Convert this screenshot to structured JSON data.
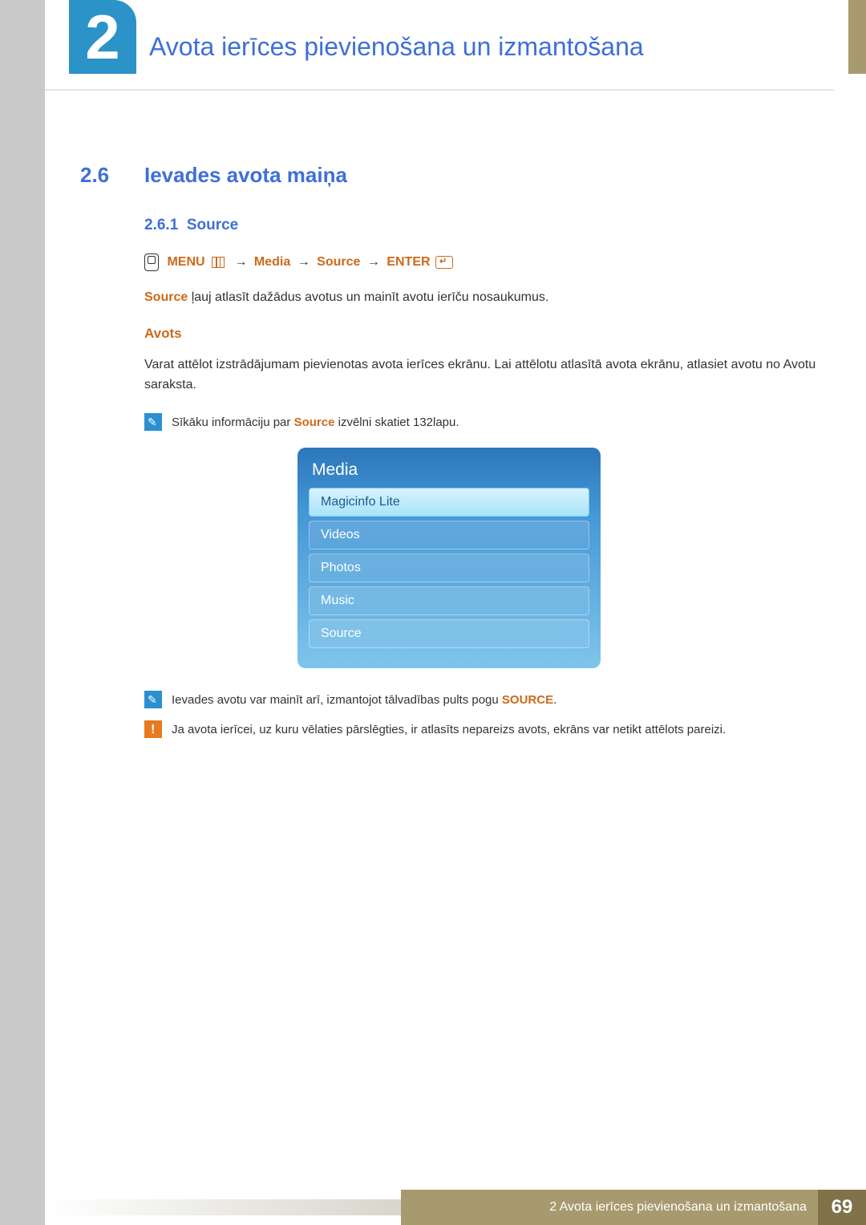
{
  "chapter": {
    "number": "2",
    "title": "Avota ierīces pievienošana un izmantošana"
  },
  "section": {
    "number": "2.6",
    "title": "Ievades avota maiņa"
  },
  "subsection": {
    "number": "2.6.1",
    "title": "Source"
  },
  "breadcrumb": {
    "menu": "MENU",
    "path1": "Media",
    "path2": "Source",
    "enter": "ENTER"
  },
  "intro": {
    "source_word": "Source",
    "rest": " ļauj atlasīt dažādus avotus un mainīt avotu ierīču nosaukumus."
  },
  "avots": {
    "heading": "Avots",
    "para": "Varat attēlot izstrādājumam pievienotas avota ierīces ekrānu. Lai attēlotu atlasītā avota ekrānu, atlasiet avotu no Avotu saraksta."
  },
  "notes": {
    "n1_pre": "Sīkāku informāciju par ",
    "n1_bold": "Source",
    "n1_post": " izvēlni skatiet 132lapu.",
    "n2_pre": "Ievades avotu var mainīt arī, izmantojot tālvadības pults pogu ",
    "n2_bold": "SOURCE",
    "n2_post": ".",
    "n3": "Ja avota ierīcei, uz kuru vēlaties pārslēgties, ir atlasīts nepareizs avots, ekrāns var netikt attēlots pareizi."
  },
  "ui": {
    "title": "Media",
    "items": [
      {
        "label": "Magicinfo Lite",
        "selected": true
      },
      {
        "label": "Videos",
        "selected": false
      },
      {
        "label": "Photos",
        "selected": false
      },
      {
        "label": "Music",
        "selected": false
      },
      {
        "label": "Source",
        "selected": false
      }
    ]
  },
  "footer": {
    "text": "2 Avota ierīces pievienošana un izmantošana",
    "page": "69"
  }
}
